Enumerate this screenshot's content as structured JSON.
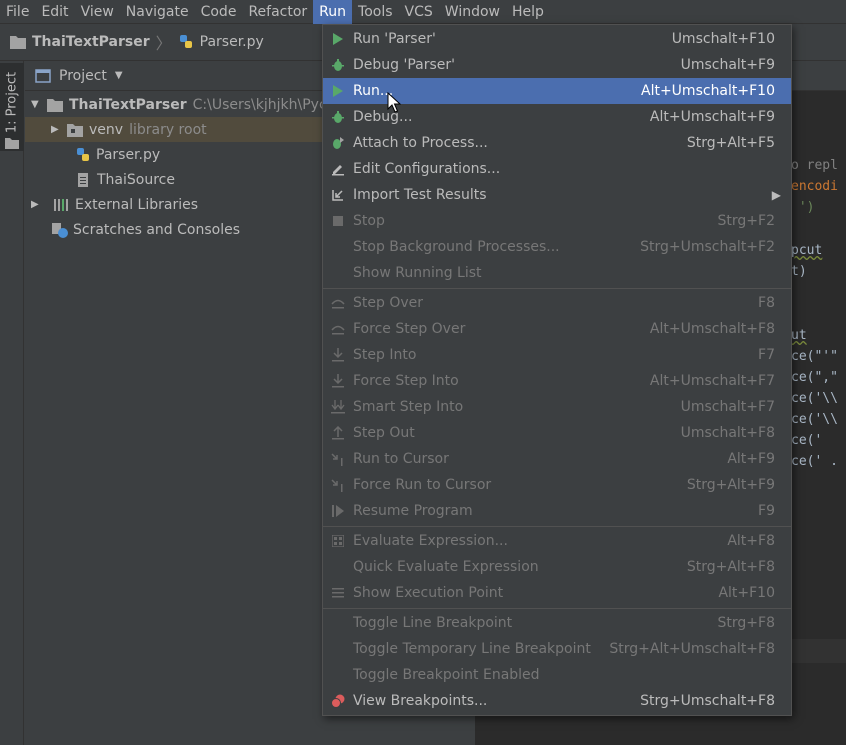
{
  "menubar": {
    "items": [
      "File",
      "Edit",
      "View",
      "Navigate",
      "Code",
      "Refactor",
      "Run",
      "Tools",
      "VCS",
      "Window",
      "Help"
    ]
  },
  "navbar": {
    "project": "ThaiTextParser",
    "file": "Parser.py"
  },
  "toolstrip": {
    "project_tab": "1: Project"
  },
  "project_panel": {
    "header": "Project",
    "tree": {
      "root": {
        "name": "ThaiTextParser",
        "path": "C:\\Users\\kjhjkh\\Pych"
      },
      "venv": {
        "name": "venv",
        "note": "library root"
      },
      "parser": "Parser.py",
      "source": "ThaiSource",
      "external": "External Libraries",
      "scratches": "Scratches and Consoles"
    }
  },
  "editor": {
    "lines": [
      "o repl",
      "encodi",
      " ')",
      "pcut",
      "t)",
      "ut",
      "ce(\"'\"",
      "ce(\",\"",
      "ce('\\\\",
      "ce('\\\\",
      "ce('",
      "ce(' ."
    ]
  },
  "run_menu": {
    "items": [
      {
        "label": "Run 'Parser'",
        "shortcut": "Umschalt+F10"
      },
      {
        "label": "Debug 'Parser'",
        "shortcut": "Umschalt+F9"
      },
      {
        "label": "Run...",
        "shortcut": "Alt+Umschalt+F10"
      },
      {
        "label": "Debug...",
        "shortcut": "Alt+Umschalt+F9"
      },
      {
        "label": "Attach to Process...",
        "shortcut": "Strg+Alt+F5"
      },
      {
        "label": "Edit Configurations...",
        "shortcut": ""
      },
      {
        "label": "Import Test Results",
        "shortcut": ""
      },
      {
        "label": "Stop",
        "shortcut": "Strg+F2"
      },
      {
        "label": "Stop Background Processes...",
        "shortcut": "Strg+Umschalt+F2"
      },
      {
        "label": "Show Running List",
        "shortcut": ""
      },
      {
        "label": "Step Over",
        "shortcut": "F8"
      },
      {
        "label": "Force Step Over",
        "shortcut": "Alt+Umschalt+F8"
      },
      {
        "label": "Step Into",
        "shortcut": "F7"
      },
      {
        "label": "Force Step Into",
        "shortcut": "Alt+Umschalt+F7"
      },
      {
        "label": "Smart Step Into",
        "shortcut": "Umschalt+F7"
      },
      {
        "label": "Step Out",
        "shortcut": "Umschalt+F8"
      },
      {
        "label": "Run to Cursor",
        "shortcut": "Alt+F9"
      },
      {
        "label": "Force Run to Cursor",
        "shortcut": "Strg+Alt+F9"
      },
      {
        "label": "Resume Program",
        "shortcut": "F9"
      },
      {
        "label": "Evaluate Expression...",
        "shortcut": "Alt+F8"
      },
      {
        "label": "Quick Evaluate Expression",
        "shortcut": "Strg+Alt+F8"
      },
      {
        "label": "Show Execution Point",
        "shortcut": "Alt+F10"
      },
      {
        "label": "Toggle Line Breakpoint",
        "shortcut": "Strg+F8"
      },
      {
        "label": "Toggle Temporary Line Breakpoint",
        "shortcut": "Strg+Alt+Umschalt+F8"
      },
      {
        "label": "Toggle Breakpoint Enabled",
        "shortcut": ""
      },
      {
        "label": "View Breakpoints...",
        "shortcut": "Strg+Umschalt+F8"
      }
    ]
  },
  "colors": {
    "background": "#3c3f41",
    "editor": "#2b2b2b",
    "selection": "#4b6eaf",
    "run_green": "#59a869",
    "breakpoint_red": "#db5c5c"
  }
}
